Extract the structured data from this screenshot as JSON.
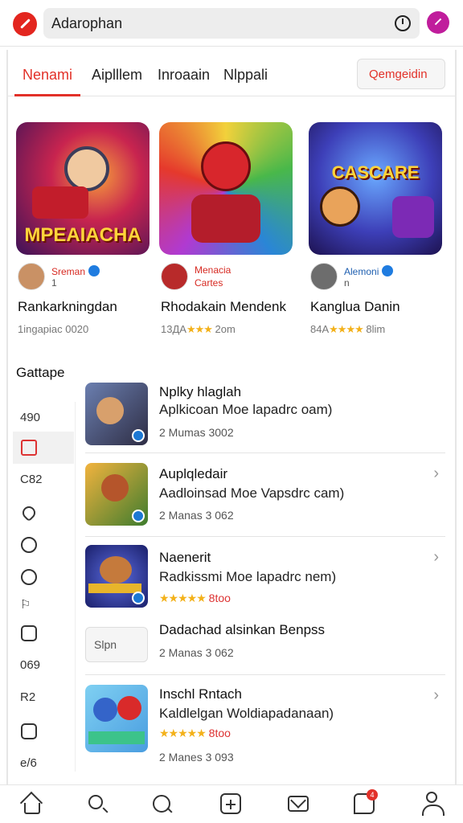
{
  "header": {
    "search_value": "Adarophan"
  },
  "tabs": [
    {
      "label": "Nenami"
    },
    {
      "label": "Aiplllem"
    },
    {
      "label": "Inroaain"
    },
    {
      "label": "Nlppali"
    }
  ],
  "category_button": {
    "label": "Qemgeidin"
  },
  "featured": [
    {
      "thumb_label": "MPEAIACHA",
      "dev_name": "Sreman",
      "dev_sub": "1",
      "title": "Rankarkningdan",
      "meta_prefix": "1іngapiac",
      "stars": "",
      "meta_suffix": "0020"
    },
    {
      "thumb_label": "",
      "dev_name": "Menacia",
      "dev_sub": "Cartes",
      "title": "Rhodakain Mendenk",
      "meta_prefix": "13ДА",
      "stars": "★★★",
      "meta_suffix": "2om"
    },
    {
      "thumb_label": "CASCARE",
      "dev_name": "Alemoni",
      "dev_sub": "n",
      "title": "Kanglua Danin",
      "meta_prefix": "84А",
      "stars": "★★★★",
      "meta_suffix": "8lim"
    }
  ],
  "section": {
    "title": "Gattape"
  },
  "sidebar": [
    "490",
    "",
    "C82",
    "",
    "",
    "",
    "",
    "",
    "069",
    "R2",
    "",
    "e/6"
  ],
  "apps": [
    {
      "title": "Nplky hlaglah",
      "desc": "Aplkicoan Moe lapadrc oam)",
      "meta": "2 Mumas 3002",
      "stars": ""
    },
    {
      "title": "Auplqledair",
      "desc": "Aadloinsad Moe Vapsdrc cam)",
      "meta": "2 Manas 3 062",
      "stars": ""
    },
    {
      "title": "Naenerit",
      "desc": "Radkissmi Moe lapadrc nem)",
      "meta": "8too",
      "stars": "★★★★★"
    },
    {
      "title": "Dadachad alsinkan Benpss",
      "desc": "",
      "meta": "2 Manas 3 062",
      "stars": "",
      "ad_label": "Slpn"
    },
    {
      "title": "Inschl Rntach",
      "desc": "Kaldlelgan Woldiapadanaan)",
      "meta": "2 Manes 3 093",
      "stars": "★★★★★",
      "meta2": "8too"
    }
  ],
  "nav_badge": "4"
}
